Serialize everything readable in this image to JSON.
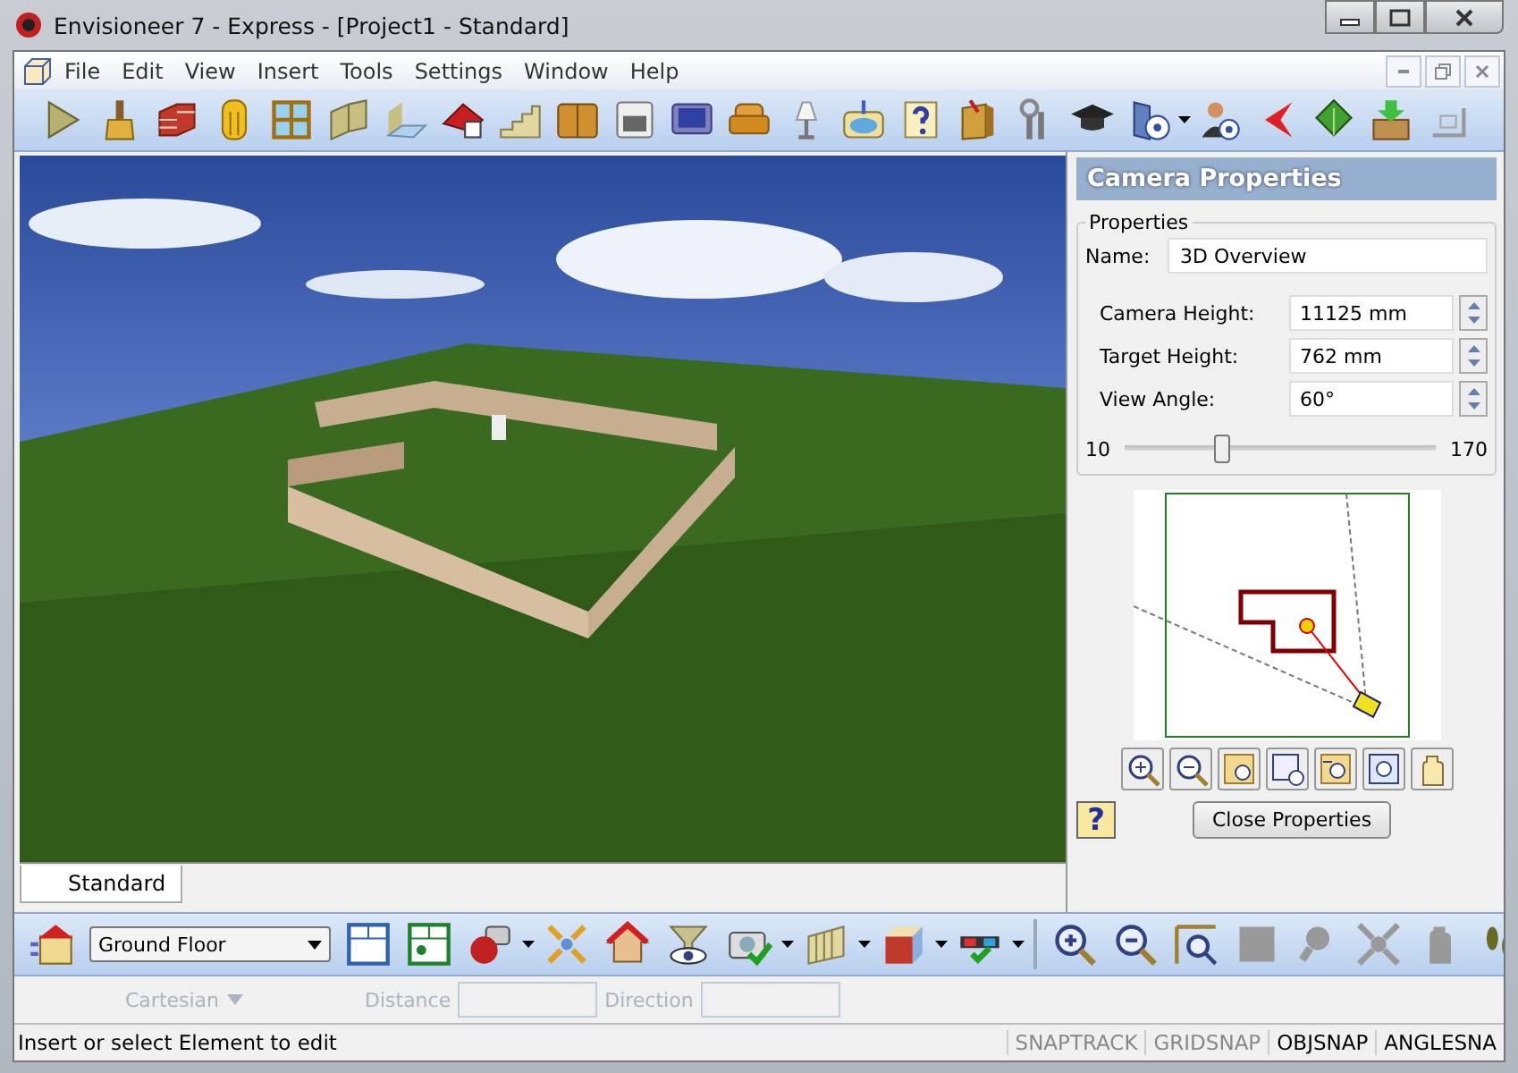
{
  "window": {
    "title": "Envisioneer 7 - Express - [Project1 - Standard]"
  },
  "menu": [
    "File",
    "Edit",
    "View",
    "Insert",
    "Tools",
    "Settings",
    "Window",
    "Help"
  ],
  "camera_panel": {
    "title": "Camera Properties",
    "group": "Properties",
    "name_label": "Name:",
    "name_value": "3D Overview",
    "fields": [
      {
        "label": "Camera Height:",
        "value": "11125 mm"
      },
      {
        "label": "Target Height:",
        "value": "762 mm"
      },
      {
        "label": "View Angle:",
        "value": "60°"
      }
    ],
    "slider": {
      "min": "10",
      "max": "170",
      "level": 0.31
    },
    "help_button": "?",
    "close_button": "Close Properties"
  },
  "tabs": [
    {
      "label": "Standard",
      "selected": true
    }
  ],
  "floor_select": {
    "value": "Ground Floor"
  },
  "coordinates": {
    "mode": "Cartesian",
    "distance_label": "Distance",
    "direction_label": "Direction",
    "disabled": true
  },
  "status_bar": {
    "message": "Insert or select Element to edit",
    "toggles": [
      {
        "label": "SNAPTRACK",
        "on": false
      },
      {
        "label": "GRIDSNAP",
        "on": false
      },
      {
        "label": "OBJSNAP",
        "on": true
      },
      {
        "label": "ANGLESNA",
        "on": true
      }
    ]
  }
}
